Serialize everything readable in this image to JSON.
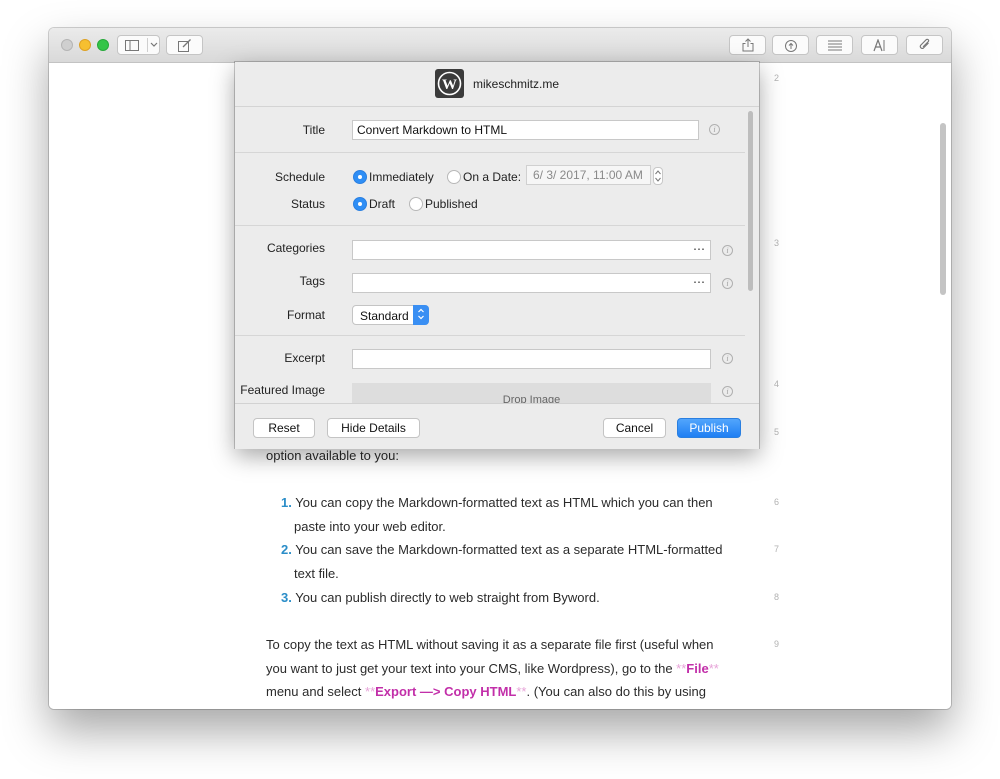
{
  "toolbar": {
    "icons": [
      "sidebar-icon",
      "chevron-down-icon",
      "compose-icon",
      "share-icon",
      "publish-cloud-icon",
      "list-icon",
      "font-icon",
      "attachment-icon"
    ]
  },
  "editor": {
    "line_numbers": [
      "2",
      "3",
      "4",
      "5",
      "6",
      "7",
      "8",
      "9"
    ],
    "line_option": "option available to you:",
    "list_items": [
      {
        "num": "1.",
        "line1": "You can copy the Markdown-formatted text as HTML which you can then",
        "line2": "paste into your web editor."
      },
      {
        "num": "2.",
        "line1": "You can save the Markdown-formatted text as a separate HTML-formatted",
        "line2": "text file."
      },
      {
        "num": "3.",
        "line1": "You can publish directly to web straight from Byword.",
        "line2": ""
      }
    ],
    "para_line1": "To copy the text as HTML without saving it as a separate file first (useful when",
    "para_line2_a": "you want to just get your text into your CMS, like Wordpress), go to the ",
    "md_bold_mark": "**",
    "file_word": "File",
    "para_line3_a": "menu and select ",
    "export_phrase": "Export —> Copy HTML",
    "para_line3_b": ". (You can also do this by using"
  },
  "dialog": {
    "site_name": "mikeschmitz.me",
    "logo_letter": "W",
    "title_label": "Title",
    "title_value": "Convert Markdown to HTML",
    "schedule_label": "Schedule",
    "schedule_options": [
      "Immediately",
      "On a Date:"
    ],
    "schedule_selected": "Immediately",
    "date_value": "6/  3/ 2017, 11:00 AM",
    "status_label": "Status",
    "status_options": [
      "Draft",
      "Published"
    ],
    "status_selected": "Draft",
    "categories_label": "Categories",
    "categories_value": "",
    "tags_label": "Tags",
    "tags_value": "",
    "more_glyph": "⋯",
    "format_label": "Format",
    "format_value": "Standard",
    "excerpt_label": "Excerpt",
    "excerpt_value": "",
    "featured_image_label": "Featured Image",
    "drop_image_label": "Drop Image",
    "info_glyph": "i",
    "buttons": {
      "reset": "Reset",
      "hide_details": "Hide Details",
      "cancel": "Cancel",
      "publish": "Publish"
    }
  },
  "colors": {
    "accent": "#2e8ef5",
    "list_number": "#2a8dc8",
    "markdown_bold": "#c22fa9",
    "markdown_mark": "#e7a3d8"
  }
}
